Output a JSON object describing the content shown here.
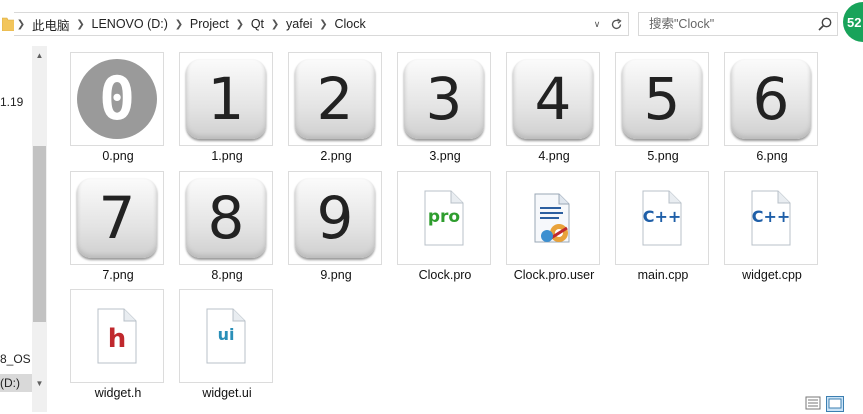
{
  "address": {
    "crumbs": [
      "此电脑",
      "LENOVO (D:)",
      "Project",
      "Qt",
      "yafei",
      "Clock"
    ]
  },
  "search": {
    "placeholder": "搜索\"Clock\""
  },
  "badge": {
    "text": "52"
  },
  "nav": {
    "items": [
      "1.19",
      "8_OS",
      "(D:)"
    ]
  },
  "files": [
    {
      "name": "0.png",
      "kind": "zero",
      "glyph": "0"
    },
    {
      "name": "1.png",
      "kind": "digit",
      "glyph": "1"
    },
    {
      "name": "2.png",
      "kind": "digit",
      "glyph": "2"
    },
    {
      "name": "3.png",
      "kind": "digit",
      "glyph": "3"
    },
    {
      "name": "4.png",
      "kind": "digit",
      "glyph": "4"
    },
    {
      "name": "5.png",
      "kind": "digit",
      "glyph": "5"
    },
    {
      "name": "6.png",
      "kind": "digit",
      "glyph": "6"
    },
    {
      "name": "7.png",
      "kind": "digit",
      "glyph": "7"
    },
    {
      "name": "8.png",
      "kind": "digit",
      "glyph": "8"
    },
    {
      "name": "9.png",
      "kind": "digit",
      "glyph": "9"
    },
    {
      "name": "Clock.pro",
      "kind": "pro",
      "glyph": "pro"
    },
    {
      "name": "Clock.pro.user",
      "kind": "user",
      "glyph": ""
    },
    {
      "name": "main.cpp",
      "kind": "cpp",
      "glyph": "C++"
    },
    {
      "name": "widget.cpp",
      "kind": "cpp",
      "glyph": "C++"
    },
    {
      "name": "widget.h",
      "kind": "h",
      "glyph": "h"
    },
    {
      "name": "widget.ui",
      "kind": "ui",
      "glyph": "ui"
    }
  ],
  "colors": {
    "pro": "#2e9d2e",
    "cpp": "#1f5fa8",
    "h": "#c0282d",
    "ui": "#2a8fb8",
    "badge": "#18a35a"
  }
}
